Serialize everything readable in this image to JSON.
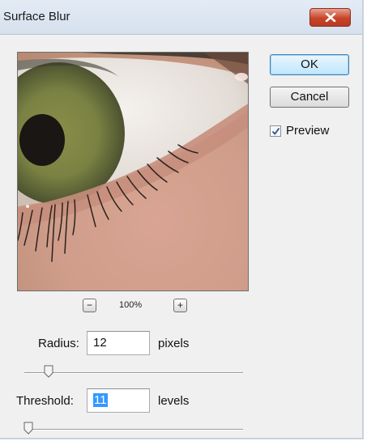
{
  "window": {
    "title": "Surface Blur",
    "close_icon": "close-icon"
  },
  "buttons": {
    "ok": "OK",
    "cancel": "Cancel"
  },
  "preview_checkbox": {
    "label": "Preview",
    "checked": true
  },
  "zoom": {
    "level": "100%",
    "minus_icon": "zoom-out-icon",
    "plus_icon": "zoom-in-icon"
  },
  "radius": {
    "label": "Radius:",
    "value": "12",
    "unit": "pixels",
    "slider_fraction": 0.11
  },
  "threshold": {
    "label": "Threshold:",
    "value": "11",
    "unit": "levels",
    "slider_fraction": 0.02
  },
  "colors": {
    "close_red": "#c7442a",
    "selection_blue": "#3399ff",
    "ok_border": "#3c7fb1"
  }
}
